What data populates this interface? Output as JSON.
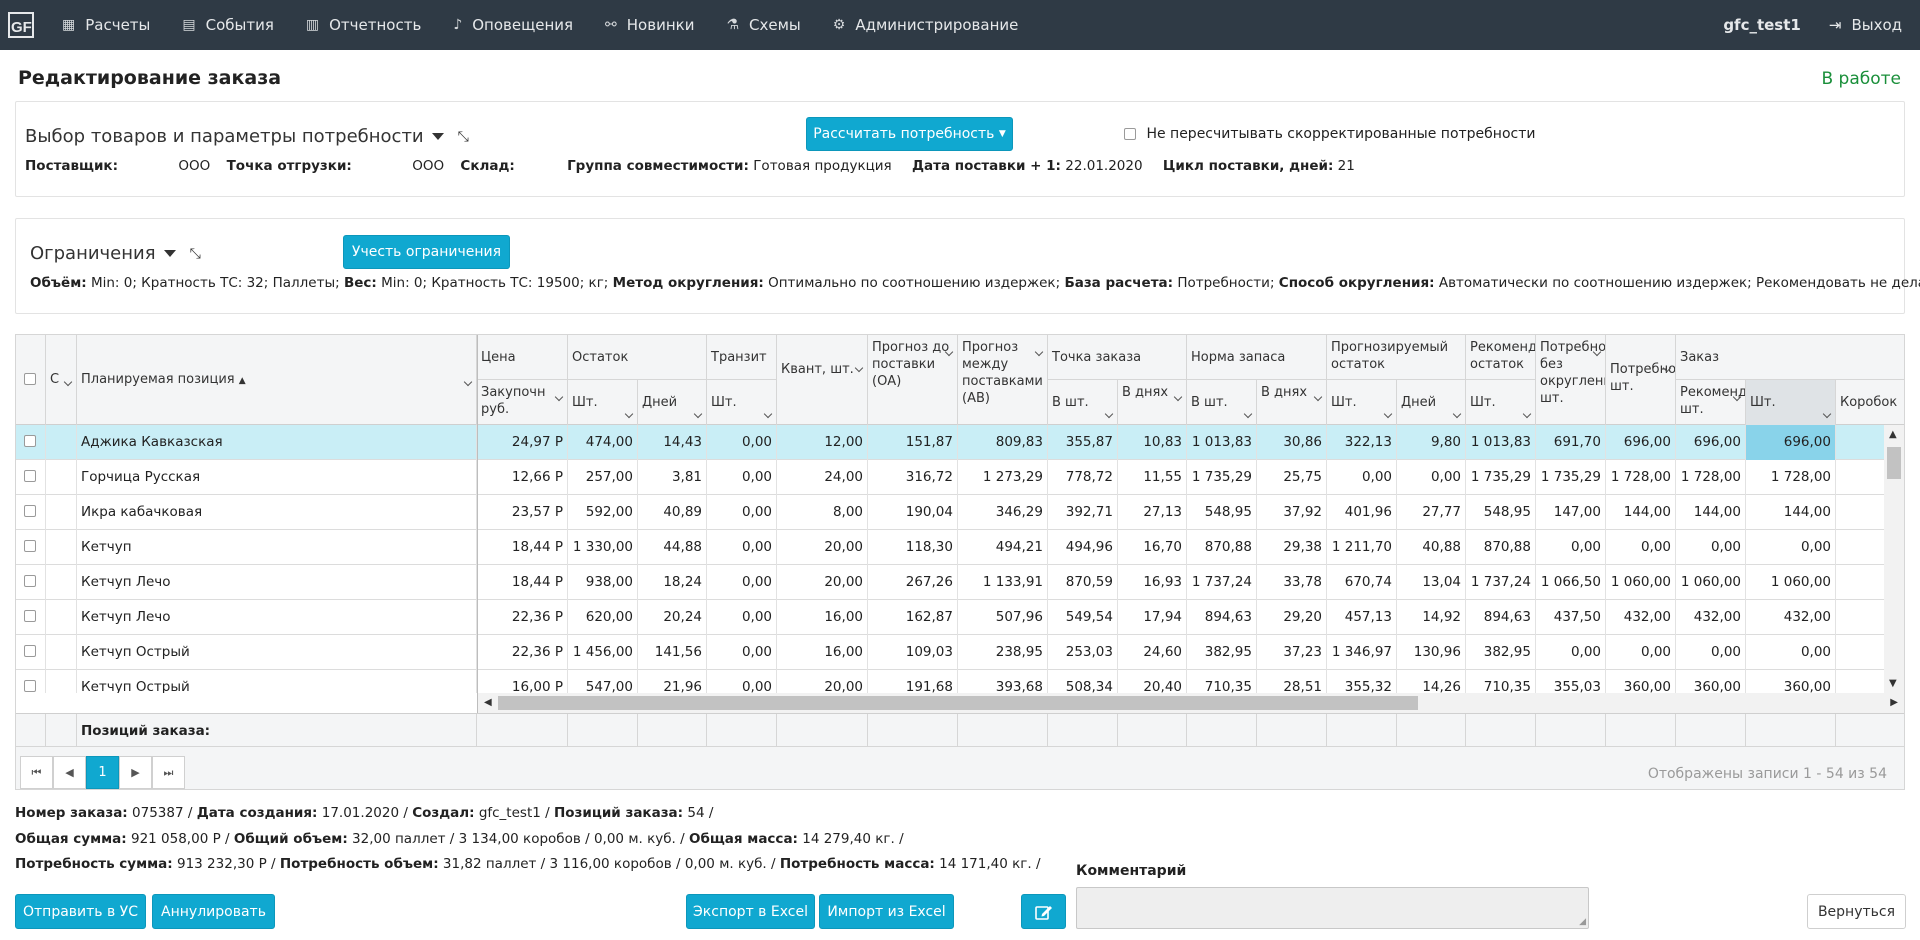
{
  "nav": {
    "items": [
      {
        "label": "Расчеты",
        "icon": "calculator-icon",
        "glyph": "▦"
      },
      {
        "label": "События",
        "icon": "calendar-icon",
        "glyph": "▤"
      },
      {
        "label": "Отчетность",
        "icon": "bar-chart-icon",
        "glyph": "▥"
      },
      {
        "label": "Оповещения",
        "icon": "bell-icon",
        "glyph": "♪"
      },
      {
        "label": "Новинки",
        "icon": "link-icon",
        "glyph": "⚯"
      },
      {
        "label": "Схемы",
        "icon": "flask-icon",
        "glyph": "⚗"
      },
      {
        "label": "Администрирование",
        "icon": "gear-icon",
        "glyph": "⚙"
      }
    ],
    "user": "gfc_test1",
    "logout": "Выход"
  },
  "page": {
    "title": "Редактирование заказа",
    "status": "В работе"
  },
  "selection": {
    "heading": "Выбор товаров и параметры потребности",
    "calc_button": "Рассчитать потребность",
    "no_recalc_label": "Не пересчитывать скорректированные потребности",
    "supplier_label": "Поставщик:",
    "supplier_value": "ООО",
    "shipping_label": "Точка отгрузки:",
    "shipping_value": "ООО",
    "warehouse_label": "Склад:",
    "group_label": "Группа совместимости:",
    "group_value": "Готовая продукция",
    "delivery_label": "Дата поставки + 1:",
    "delivery_value": "22.01.2020",
    "cycle_label": "Цикл поставки, дней:",
    "cycle_value": "21"
  },
  "limits": {
    "heading": "Ограничения",
    "button": "Учесть ограничения",
    "volume_label": "Объём:",
    "volume_value": "Min: 0; Кратность ТС: 32; Паллеты;",
    "weight_label": "Вес:",
    "weight_value": "Min: 0; Кратность ТС: 19500; кг;",
    "method_label": "Метод округления:",
    "method_value": "Оптимально по соотношению издержек;",
    "base_label": "База расчета:",
    "base_value": "Потребности;",
    "way_label": "Способ округления:",
    "way_value": "Автоматически по соотношению издержек;  Рекомендовать не делать заказ;"
  },
  "grid": {
    "headers": {
      "c": "С",
      "position": "Планируемая позиция",
      "price": "Цена",
      "purchase": "Закупочн руб.",
      "rest": "Остаток",
      "pcs": "Шт.",
      "days": "Дней",
      "transit": "Транзит",
      "quant": "Квант, шт.",
      "forecast_oa": "Прогноз до поставки (ОА)",
      "forecast_ab": "Прогноз между поставками (АВ)",
      "order_point": "Точка заказа",
      "in_pcs": "В шт.",
      "in_days": "В днях",
      "norm": "Норма запаса",
      "proj_rest": "Прогнозируемый остаток",
      "rec_rest": "Рекомендуемый остаток",
      "need_round": "Потребность без округления шт.",
      "need": "Потребность шт.",
      "order": "Заказ",
      "rec_pcs": "Рекомендовано шт.",
      "boxes": "Коробок"
    },
    "rows": [
      {
        "name": "Аджика Кавказская",
        "v": [
          "24,97 Р",
          "474,00",
          "14,43",
          "0,00",
          "12,00",
          "151,87",
          "809,83",
          "355,87",
          "10,83",
          "1 013,83",
          "30,86",
          "322,13",
          "9,80",
          "1 013,83",
          "691,70",
          "696,00",
          "696,00",
          "696,00"
        ]
      },
      {
        "name": "Горчица Русская",
        "v": [
          "12,66 Р",
          "257,00",
          "3,81",
          "0,00",
          "24,00",
          "316,72",
          "1 273,29",
          "778,72",
          "11,55",
          "1 735,29",
          "25,75",
          "0,00",
          "0,00",
          "1 735,29",
          "1 735,29",
          "1 728,00",
          "1 728,00",
          "1 728,00"
        ]
      },
      {
        "name": "Икра кабачковая",
        "v": [
          "23,57 Р",
          "592,00",
          "40,89",
          "0,00",
          "8,00",
          "190,04",
          "346,29",
          "392,71",
          "27,13",
          "548,95",
          "37,92",
          "401,96",
          "27,77",
          "548,95",
          "147,00",
          "144,00",
          "144,00",
          "144,00"
        ]
      },
      {
        "name": "Кетчуп",
        "v": [
          "18,44 Р",
          "1 330,00",
          "44,88",
          "0,00",
          "20,00",
          "118,30",
          "494,21",
          "494,96",
          "16,70",
          "870,88",
          "29,38",
          "1 211,70",
          "40,88",
          "870,88",
          "0,00",
          "0,00",
          "0,00",
          "0,00"
        ]
      },
      {
        "name": "Кетчуп Лечо",
        "v": [
          "18,44 Р",
          "938,00",
          "18,24",
          "0,00",
          "20,00",
          "267,26",
          "1 133,91",
          "870,59",
          "16,93",
          "1 737,24",
          "33,78",
          "670,74",
          "13,04",
          "1 737,24",
          "1 066,50",
          "1 060,00",
          "1 060,00",
          "1 060,00"
        ]
      },
      {
        "name": "Кетчуп Лечо",
        "v": [
          "22,36 Р",
          "620,00",
          "20,24",
          "0,00",
          "16,00",
          "162,87",
          "507,96",
          "549,54",
          "17,94",
          "894,63",
          "29,20",
          "457,13",
          "14,92",
          "894,63",
          "437,50",
          "432,00",
          "432,00",
          "432,00"
        ]
      },
      {
        "name": "Кетчуп Острый",
        "v": [
          "22,36 Р",
          "1 456,00",
          "141,56",
          "0,00",
          "16,00",
          "109,03",
          "238,95",
          "253,03",
          "24,60",
          "382,95",
          "37,23",
          "1 346,97",
          "130,96",
          "382,95",
          "0,00",
          "0,00",
          "0,00",
          "0,00"
        ]
      },
      {
        "name": "Кетчуп Острый",
        "v": [
          "16,00 Р",
          "547,00",
          "21,96",
          "0,00",
          "20,00",
          "191,68",
          "393,68",
          "508,34",
          "20,40",
          "710,35",
          "28,51",
          "355,32",
          "14,26",
          "710,35",
          "355,03",
          "360,00",
          "360,00",
          "360,00"
        ]
      }
    ],
    "footer_label": "Позиций заказа:",
    "pager_current": "1",
    "pager_info": "Отображены записи 1 - 54 из 54"
  },
  "summary": {
    "line1": [
      {
        "label": "Номер заказа:",
        "value": "075387 /"
      },
      {
        "label": "Дата создания:",
        "value": "17.01.2020 /"
      },
      {
        "label": "Создал:",
        "value": "gfc_test1 /"
      },
      {
        "label": "Позиций заказа:",
        "value": "54 /"
      }
    ],
    "line2": [
      {
        "label": "Общая сумма:",
        "value": "921 058,00 Р /"
      },
      {
        "label": "Общий объем:",
        "value": "32,00 паллет / 3 134,00 коробов / 0,00 м. куб. /"
      },
      {
        "label": "Общая масса:",
        "value": "14 279,40 кг. /"
      }
    ],
    "line3": [
      {
        "label": "Потребность сумма:",
        "value": "913 232,30 Р /"
      },
      {
        "label": "Потребность объем:",
        "value": "31,82 паллет / 3 116,00 коробов / 0,00 м. куб. /"
      },
      {
        "label": "Потребность масса:",
        "value": "14 171,40 кг. /"
      }
    ]
  },
  "actions": {
    "send": "Отправить в УС",
    "cancel": "Аннулировать",
    "export": "Экспорт в Excel",
    "import": "Импорт из Excel",
    "comment_label": "Комментарий",
    "back": "Вернуться"
  }
}
